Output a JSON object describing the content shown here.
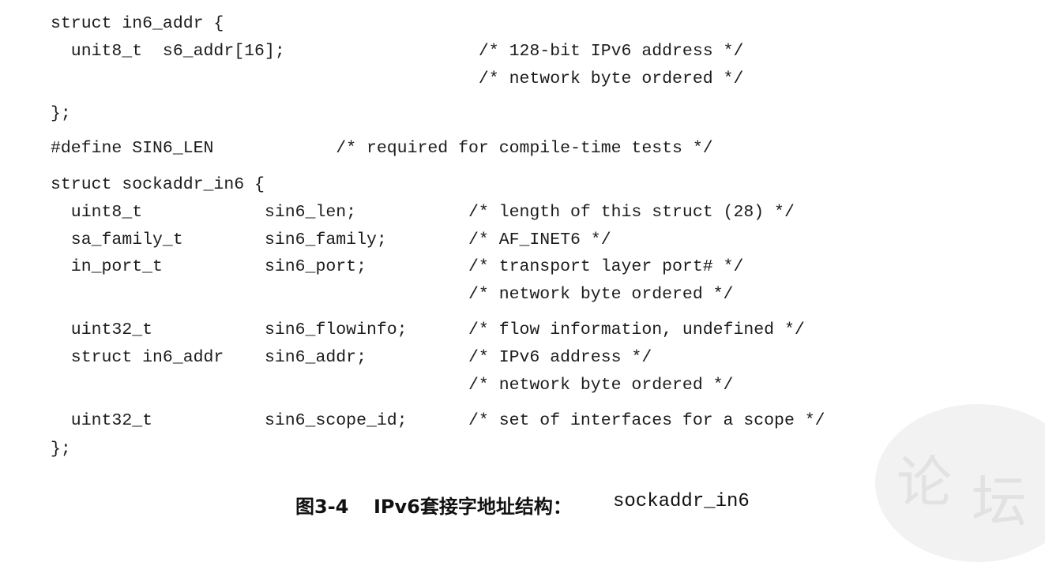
{
  "code_lines": [
    "struct in6_addr {",
    "  unit8_t  s6_addr[16];                   /* 128-bit IPv6 address */",
    "                                          /* network byte ordered */",
    "};",
    "#define SIN6_LEN            /* required for compile-time tests */",
    "struct sockaddr_in6 {",
    "  uint8_t            sin6_len;           /* length of this struct (28) */",
    "  sa_family_t        sin6_family;        /* AF_INET6 */",
    "  in_port_t          sin6_port;          /* transport layer port# */",
    "                                         /* network byte ordered */",
    "  uint32_t           sin6_flowinfo;      /* flow information, undefined */",
    "  struct in6_addr    sin6_addr;          /* IPv6 address */",
    "                                         /* network byte ordered */",
    "  uint32_t           sin6_scope_id;      /* set of interfaces for a scope */",
    "};"
  ],
  "caption": {
    "label": "图3-4",
    "title": "IPv6套接字地址结构：",
    "code": "sockaddr_in6"
  },
  "watermark": {
    "glyphs": [
      "论",
      "坛"
    ]
  }
}
